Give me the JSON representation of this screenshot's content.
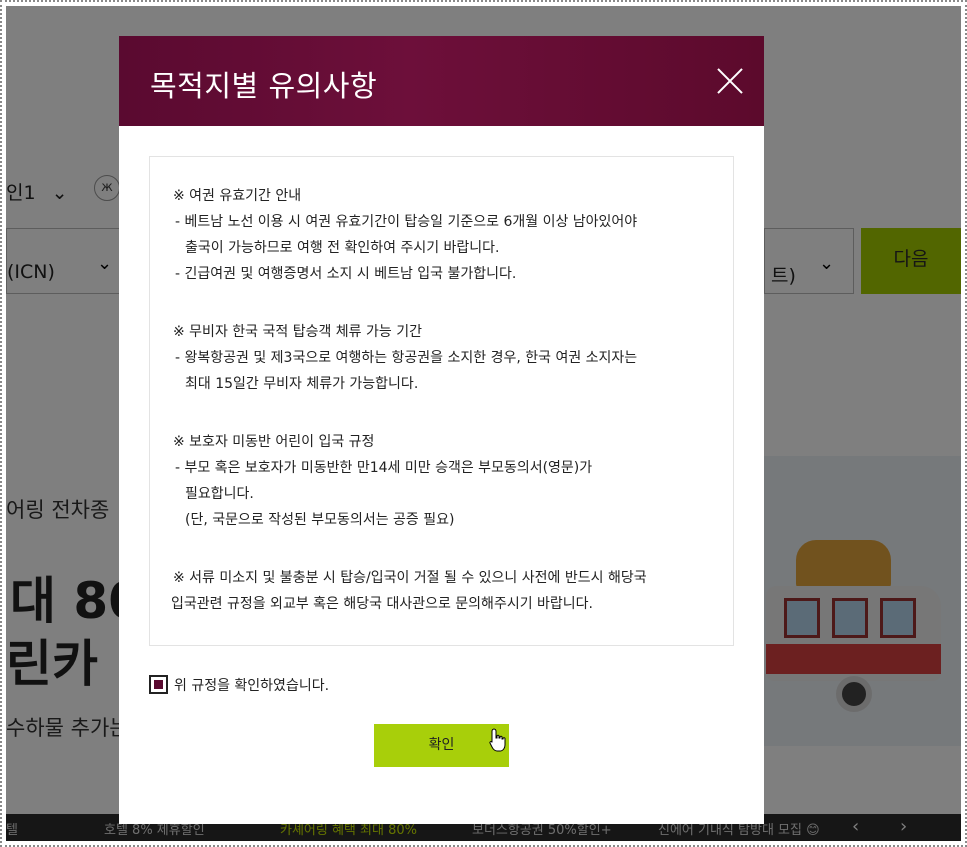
{
  "background": {
    "passenger_label": "인1",
    "origin_value": "(ICN)",
    "dest_value": "트)",
    "next_button": "다음",
    "hero_sub": "어링 전차종",
    "hero_title_line1": "대 80",
    "hero_title_line2": "린카",
    "hero_sub2": "수하물 추가는 단",
    "ticker": [
      "텔",
      "호텔 8% 제휴할인",
      "카셰어링 혜택 최대 80%",
      "보더스항공권 50%할인+",
      "신에어 기내식 탐방대 모집 😊"
    ]
  },
  "modal": {
    "title": "목적지별 유의사항",
    "sections": [
      {
        "heading": "※ 여권 유효기간 안내",
        "lines": [
          "- 베트남 노선 이용 시 여권 유효기간이 탑승일 기준으로 6개월 이상 남아있어야",
          "출국이 가능하므로 여행 전 확인하여 주시기 바랍니다.",
          "- 긴급여권 및 여행증명서 소지 시 베트남 입국 불가합니다."
        ]
      },
      {
        "heading": "※ 무비자 한국 국적 탑승객 체류 가능 기간",
        "lines": [
          "- 왕복항공권 및 제3국으로 여행하는 항공권을 소지한 경우, 한국 여권 소지자는",
          "최대 15일간 무비자 체류가 가능합니다."
        ]
      },
      {
        "heading": "※ 보호자 미동반 어린이 입국 규정",
        "lines": [
          "- 부모 혹은 보호자가 미동반한 만14세 미만 승객은 부모동의서(영문)가",
          "필요합니다.",
          "(단, 국문으로 작성된 부모동의서는 공증 필요)"
        ]
      }
    ],
    "footer_note_line1": "※ 서류 미소지 및 불충분 시 탑승/입국이 거절 될 수 있으니 사전에 반드시 해당국",
    "footer_note_line2": "입국관련 규정을 외교부 혹은 해당국 대사관으로 문의해주시기 바랍니다.",
    "agree_label": "위 규정을 확인하였습니다.",
    "agree_checked": true,
    "confirm_button": "확인"
  },
  "colors": {
    "header": "#5a0a30",
    "accent_green": "#a8cf0a"
  },
  "icons": [
    "close-icon",
    "chevron-down-icon",
    "butterfly-icon",
    "pointer-cursor-icon",
    "checkbox-checked-icon"
  ]
}
